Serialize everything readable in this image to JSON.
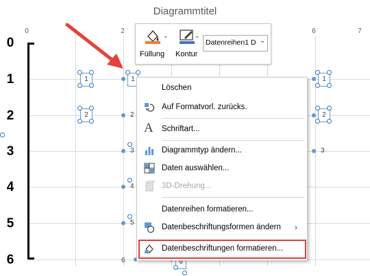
{
  "chart": {
    "title": "Diagrammtitel",
    "y_ticks": [
      "0",
      "1",
      "2",
      "3",
      "4",
      "5",
      "6"
    ],
    "x_ticks": [
      "0",
      "2",
      "6",
      "7"
    ],
    "labels": {
      "box_1a": "1",
      "box_2a": "2",
      "sel_1": "1",
      "lbl_2": "2",
      "lbl_3a": "3",
      "lbl_4": "4",
      "lbl_5": "5",
      "lbl_6": "6",
      "box_6": "6",
      "box_1b": "1",
      "box_2b": "2",
      "lbl_3b": "3"
    }
  },
  "format_bar": {
    "fill_label": "Füllung",
    "outline_label": "Kontur",
    "series_select": "Datenreihen1 D",
    "fill_color": "#ed7d31",
    "outline_color": "#4472c4"
  },
  "context_menu": {
    "items": [
      {
        "label": "Löschen",
        "icon": ""
      },
      {
        "label": "Auf Formatvorl. zurücks.",
        "icon": "reset-style-icon"
      },
      {
        "label": "Schriftart...",
        "icon": "font-icon"
      },
      {
        "label": "Diagrammtyp ändern...",
        "icon": "chart-type-icon"
      },
      {
        "label": "Daten auswählen...",
        "icon": "select-data-icon"
      },
      {
        "label": "3D-Drehung...",
        "icon": "3d-rotation-icon",
        "disabled": true
      },
      {
        "label": "Datenreihen formatieren...",
        "icon": ""
      },
      {
        "label": "Datenbeschriftungsformen ändern",
        "icon": "label-shapes-icon",
        "submenu": true
      },
      {
        "label": "Datenbeschriftungen formatieren...",
        "icon": "format-labels-icon",
        "highlighted": true
      }
    ]
  },
  "colors": {
    "accent": "#5b9bd5",
    "highlight_border": "#e03c3c",
    "arrow": "#e8413b"
  }
}
